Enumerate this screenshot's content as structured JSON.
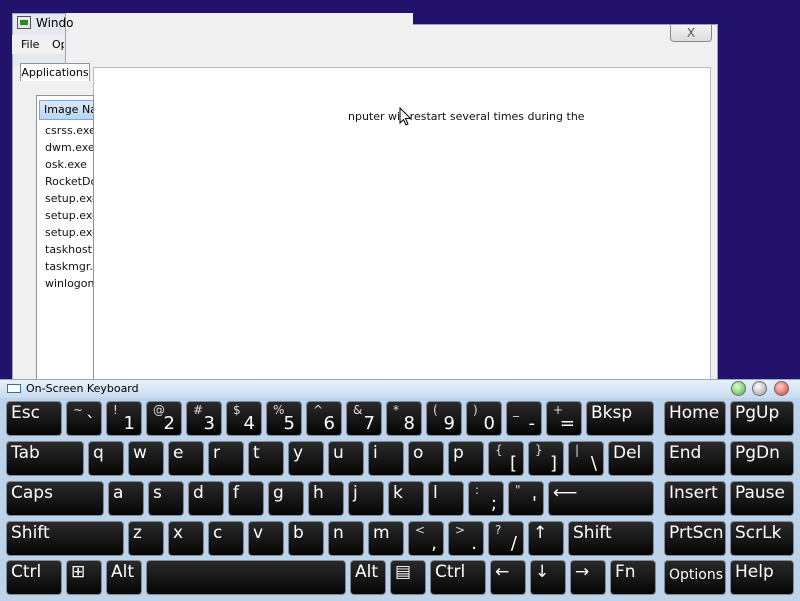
{
  "taskmgr": {
    "title": "Windo",
    "menu": {
      "file": "File",
      "options": "Op"
    },
    "tab": "Applications",
    "column": "Image Name",
    "processes": [
      "csrss.exe",
      "dwm.exe",
      "osk.exe",
      "RocketDoc",
      "setup.exe",
      "setup.exe",
      "setup.exe",
      "taskhost.e",
      "taskmgr.e",
      "winlogon.e"
    ]
  },
  "setup": {
    "close": "X",
    "message": "nputer will restart several times during the"
  },
  "osk": {
    "title": "On-Screen Keyboard",
    "rows": [
      [
        {
          "label": "Esc"
        },
        {
          "top": "~",
          "bot": "`"
        },
        {
          "top": "!",
          "bot": "1"
        },
        {
          "top": "@",
          "bot": "2"
        },
        {
          "top": "#",
          "bot": "3"
        },
        {
          "top": "$",
          "bot": "4"
        },
        {
          "top": "%",
          "bot": "5"
        },
        {
          "top": "^",
          "bot": "6"
        },
        {
          "top": "&",
          "bot": "7"
        },
        {
          "top": "*",
          "bot": "8"
        },
        {
          "top": "(",
          "bot": "9"
        },
        {
          "top": ")",
          "bot": "0"
        },
        {
          "top": "_",
          "bot": "-"
        },
        {
          "top": "+",
          "bot": "="
        },
        {
          "label": "Bksp"
        },
        {
          "label": "Home"
        },
        {
          "label": "PgUp"
        }
      ],
      [
        {
          "label": "Tab"
        },
        {
          "label": "q"
        },
        {
          "label": "w"
        },
        {
          "label": "e"
        },
        {
          "label": "r"
        },
        {
          "label": "t"
        },
        {
          "label": "y"
        },
        {
          "label": "u"
        },
        {
          "label": "i"
        },
        {
          "label": "o"
        },
        {
          "label": "p"
        },
        {
          "top": "{",
          "bot": "["
        },
        {
          "top": "}",
          "bot": "]"
        },
        {
          "top": "|",
          "bot": "\\"
        },
        {
          "label": "Del"
        },
        {
          "label": "End"
        },
        {
          "label": "PgDn"
        }
      ],
      [
        {
          "label": "Caps"
        },
        {
          "label": "a"
        },
        {
          "label": "s"
        },
        {
          "label": "d"
        },
        {
          "label": "f"
        },
        {
          "label": "g"
        },
        {
          "label": "h"
        },
        {
          "label": "j"
        },
        {
          "label": "k"
        },
        {
          "label": "l"
        },
        {
          "top": ":",
          "bot": ";"
        },
        {
          "top": "\"",
          "bot": "'"
        },
        {
          "label": "⟵"
        },
        {
          "label": "Insert"
        },
        {
          "label": "Pause"
        }
      ],
      [
        {
          "label": "Shift"
        },
        {
          "label": "z"
        },
        {
          "label": "x"
        },
        {
          "label": "c"
        },
        {
          "label": "v"
        },
        {
          "label": "b"
        },
        {
          "label": "n"
        },
        {
          "label": "m"
        },
        {
          "top": "<",
          "bot": ","
        },
        {
          "top": ">",
          "bot": "."
        },
        {
          "top": "?",
          "bot": "/"
        },
        {
          "label": "↑"
        },
        {
          "label": "Shift"
        },
        {
          "label": "PrtScn"
        },
        {
          "label": "ScrLk"
        }
      ],
      [
        {
          "label": "Ctrl"
        },
        {
          "label": "⊞"
        },
        {
          "label": "Alt"
        },
        {
          "label": ""
        },
        {
          "label": "Alt"
        },
        {
          "label": "▤"
        },
        {
          "label": "Ctrl"
        },
        {
          "label": "←"
        },
        {
          "label": "↓"
        },
        {
          "label": "→"
        },
        {
          "label": "Fn"
        },
        {
          "label": "Options"
        },
        {
          "label": "Help"
        }
      ]
    ]
  }
}
